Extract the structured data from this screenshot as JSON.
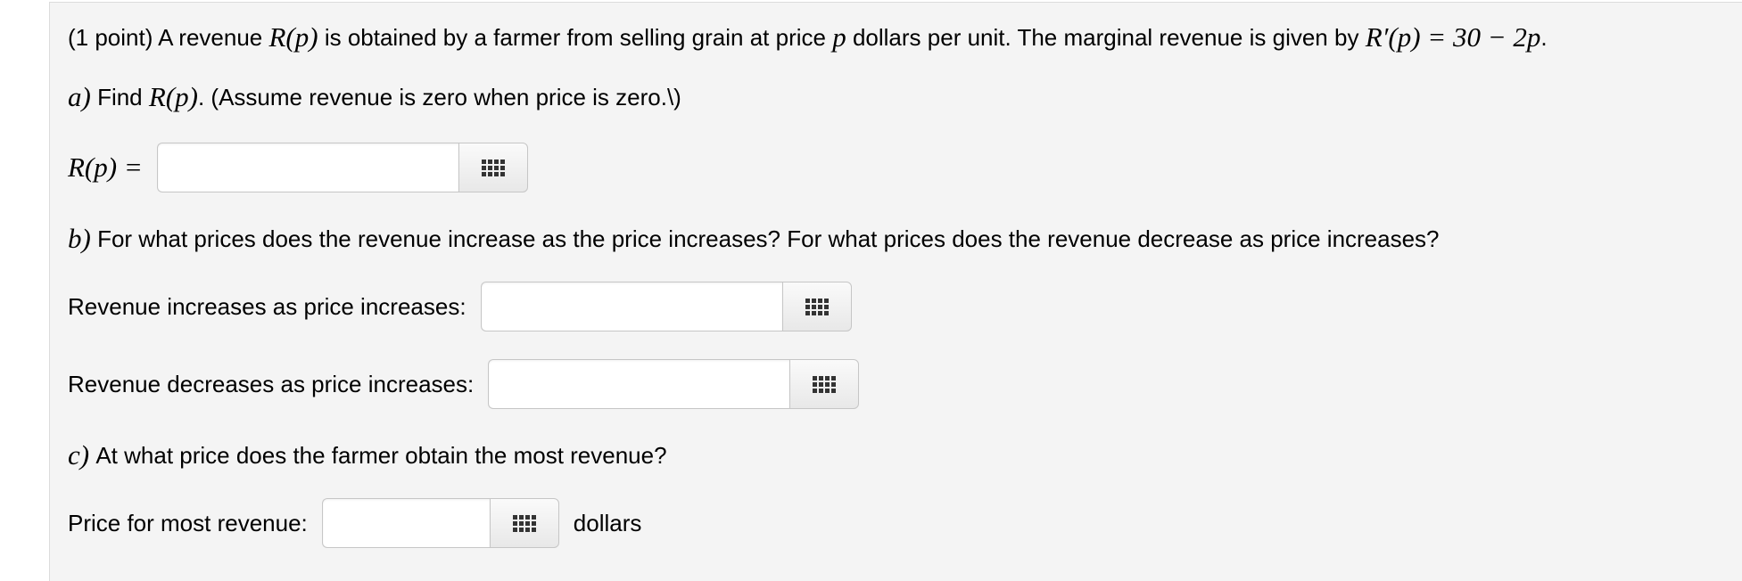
{
  "problem": {
    "intro_prefix": "(1 point) A revenue",
    "intro_mid1": "is obtained by a farmer from selling grain at price",
    "intro_mid2": "dollars per unit. The marginal revenue is given by",
    "R_of_p": "R(p)",
    "p": "p",
    "marginal": "R′(p) = 30 − 2p",
    "period": "."
  },
  "part_a": {
    "letter": "a)",
    "text_prefix": "Find",
    "R_of_p": "R(p)",
    "text_suffix": ". (Assume revenue is zero when price is zero.\\)",
    "answer_label": "R(p) =",
    "answer_value": ""
  },
  "part_b": {
    "letter": "b)",
    "text": "For what prices does the revenue increase as the price increases? For what prices does the revenue decrease as price increases?",
    "increase_label": "Revenue increases as price increases:",
    "increase_value": "",
    "decrease_label": "Revenue decreases as price increases:",
    "decrease_value": ""
  },
  "part_c": {
    "letter": "c)",
    "text": "At what price does the farmer obtain the most revenue?",
    "price_label": "Price for most revenue:",
    "price_value": "",
    "units": "dollars"
  },
  "icons": {
    "palette": "grid-icon"
  },
  "colors": {
    "panel_background": "#f4f4f4",
    "input_border": "#c6c6c6"
  }
}
